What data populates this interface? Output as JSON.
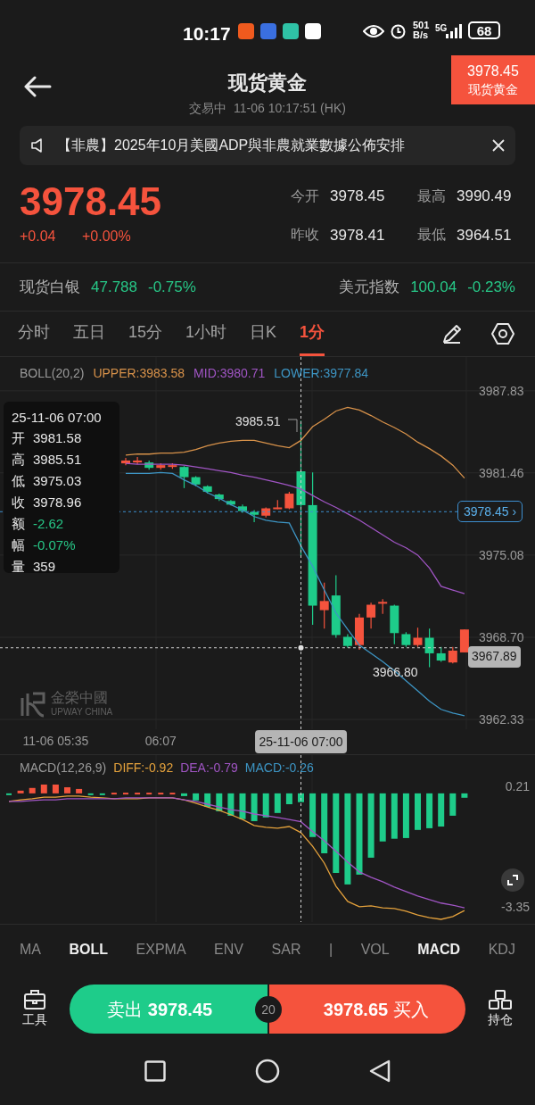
{
  "status_bar": {
    "time": "10:17",
    "speed_value": "501",
    "speed_unit": "B/s",
    "network": "5G",
    "battery": "68"
  },
  "header": {
    "title": "现货黄金",
    "state": "交易中",
    "timestamp": "11-06 10:17:51 (HK)",
    "price_tag": {
      "price": "3978.45",
      "name": "现货黄金"
    }
  },
  "notice": {
    "text": "【非農】2025年10月美國ADP與非農就業數據公佈安排"
  },
  "quote": {
    "price": "3978.45",
    "change": "+0.04",
    "change_pct": "+0.00%",
    "stats": [
      {
        "label": "今开",
        "value": "3978.45"
      },
      {
        "label": "最高",
        "value": "3990.49"
      },
      {
        "label": "昨收",
        "value": "3978.41"
      },
      {
        "label": "最低",
        "value": "3964.51"
      }
    ]
  },
  "related": [
    {
      "name": "现货白银",
      "price": "47.788",
      "change": "-0.75%"
    },
    {
      "name": "美元指数",
      "price": "100.04",
      "change": "-0.23%"
    }
  ],
  "period_tabs": [
    {
      "label": "分时",
      "selected": false
    },
    {
      "label": "五日",
      "selected": false
    },
    {
      "label": "15分",
      "selected": false
    },
    {
      "label": "1小时",
      "selected": false
    },
    {
      "label": "日K",
      "selected": false
    },
    {
      "label": "1分",
      "selected": true
    }
  ],
  "chart": {
    "legend": [
      {
        "text": "BOLL(20,2)",
        "color": "#9a9a9a"
      },
      {
        "text": "UPPER:3983.58",
        "color": "#d8924a"
      },
      {
        "text": "MID:3980.71",
        "color": "#a055c4"
      },
      {
        "text": "LOWER:3977.84",
        "color": "#3d95c4"
      }
    ],
    "current_price_arrow": "›",
    "high_mark": "3985.51",
    "low_mark": "3966.80",
    "watermark": {
      "name": "金榮中國",
      "english": "UPWAY CHINA"
    },
    "tooltip": {
      "title": "25-11-06 07:00",
      "rows": [
        {
          "label": "开",
          "value": "3981.58",
          "color": "#e8e8e8"
        },
        {
          "label": "高",
          "value": "3985.51",
          "color": "#e8e8e8"
        },
        {
          "label": "低",
          "value": "3975.03",
          "color": "#e8e8e8"
        },
        {
          "label": "收",
          "value": "3978.96",
          "color": "#e8e8e8"
        },
        {
          "label": "额",
          "value": "-2.62",
          "color": "#27c787"
        },
        {
          "label": "幅",
          "value": "-0.07%",
          "color": "#27c787"
        },
        {
          "label": "量",
          "value": "359",
          "color": "#e8e8e8"
        }
      ]
    },
    "chart_data": {
      "type": "candlestick",
      "grid": true,
      "ylim": [
        3961.57,
        3990.45
      ],
      "categories": [
        null,
        null,
        null,
        null,
        "11-06 05:35",
        null,
        null,
        null,
        null,
        null,
        null,
        null,
        null,
        "06:07",
        null,
        null,
        null,
        null,
        null,
        null,
        null,
        null,
        null,
        null,
        null,
        "25-11-06 07:00",
        null,
        null,
        null,
        null,
        null,
        null,
        null,
        null,
        null,
        null,
        null,
        null,
        null,
        null
      ],
      "yticks": [
        {
          "value": 3987.83,
          "label": "3987.83"
        },
        {
          "value": 3981.46,
          "label": "3981.46"
        },
        {
          "value": 3975.08,
          "label": "3975.08"
        },
        {
          "value": 3968.7,
          "label": "3968.70"
        },
        {
          "value": 3962.33,
          "label": "3962.33"
        }
      ],
      "ohlc": [
        null,
        null,
        null,
        null,
        null,
        null,
        null,
        null,
        null,
        null,
        [
          3982.2,
          3982.63,
          3982.06,
          3982.42
        ],
        [
          3982.27,
          3982.7,
          3982.13,
          3982.42
        ],
        [
          3982.27,
          3982.42,
          3981.7,
          3981.85
        ],
        [
          3981.85,
          3982.2,
          3981.7,
          3982.06
        ],
        [
          3981.92,
          3982.2,
          3981.78,
          3982.06
        ],
        [
          3981.92,
          3981.99,
          3980.28,
          3981.13
        ],
        [
          3981.13,
          3981.21,
          3980.42,
          3980.56
        ],
        [
          3980.42,
          3980.49,
          3979.85,
          3979.99
        ],
        [
          3979.78,
          3979.85,
          3979.28,
          3979.43
        ],
        [
          3979.28,
          3979.35,
          3978.93,
          3979.0
        ],
        [
          3978.86,
          3979.0,
          3978.36,
          3978.5
        ],
        [
          3978.43,
          3978.57,
          3977.64,
          3978.21
        ],
        [
          3978.14,
          3978.78,
          3978.0,
          3978.71
        ],
        [
          3978.71,
          3979.35,
          3978.64,
          3978.78
        ],
        [
          3978.71,
          3979.99,
          3978.64,
          3979.85
        ],
        [
          3981.58,
          3985.51,
          3975.03,
          3978.96
        ],
        [
          3978.96,
          3981.49,
          3969.67,
          3971.16
        ],
        [
          3970.81,
          3972.94,
          3969.38,
          3971.52
        ],
        [
          3971.95,
          3973.51,
          3968.67,
          3968.88
        ],
        [
          3968.74,
          3968.95,
          3967.89,
          3968.03
        ],
        [
          3968.1,
          3970.52,
          3967.74,
          3970.24
        ],
        [
          3970.24,
          3971.38,
          3969.38,
          3971.23
        ],
        [
          3971.31,
          3971.66,
          3970.52,
          3971.45
        ],
        [
          3971.16,
          3971.23,
          3968.17,
          3969.03
        ],
        [
          3968.95,
          3969.1,
          3967.96,
          3968.1
        ],
        [
          3968.1,
          3969.45,
          3967.96,
          3968.67
        ],
        [
          3968.67,
          3969.38,
          3966.39,
          3967.46
        ],
        [
          3967.46,
          3967.96,
          3966.8,
          3966.9
        ],
        [
          3966.75,
          3967.96,
          3966.68,
          3967.67
        ],
        [
          3967.53,
          3969.31,
          3967.53,
          3969.31
        ]
      ],
      "series": [
        {
          "type": "line",
          "color": "#d8924a",
          "values": [
            null,
            null,
            null,
            null,
            null,
            null,
            null,
            null,
            null,
            null,
            3982.84,
            3982.92,
            3982.92,
            3982.99,
            3982.99,
            3983.06,
            3983.27,
            3983.56,
            3983.77,
            3983.91,
            3983.98,
            3983.98,
            3983.77,
            3983.56,
            3983.41,
            3983.98,
            3985.05,
            3985.62,
            3986.26,
            3986.55,
            3986.33,
            3985.91,
            3985.41,
            3984.98,
            3984.48,
            3983.84,
            3983.34,
            3982.77,
            3982.06,
            3981.06
          ]
        },
        {
          "type": "line",
          "color": "#a055c4",
          "values": [
            null,
            null,
            null,
            null,
            null,
            null,
            null,
            null,
            null,
            null,
            3982.2,
            3982.13,
            3982.13,
            3982.13,
            3982.13,
            3982.06,
            3981.92,
            3981.78,
            3981.63,
            3981.49,
            3981.28,
            3981.13,
            3980.92,
            3980.71,
            3980.49,
            3980.21,
            3979.71,
            3979.21,
            3978.78,
            3978.29,
            3977.79,
            3977.22,
            3976.65,
            3976.08,
            3975.65,
            3975.08,
            3974.08,
            3972.66,
            3972.37,
            3972.09
          ]
        },
        {
          "type": "line",
          "color": "#3d95c4",
          "values": [
            null,
            null,
            null,
            null,
            null,
            null,
            null,
            null,
            null,
            null,
            3981.42,
            3981.42,
            3981.42,
            3981.49,
            3981.42,
            3980.92,
            3980.49,
            3979.92,
            3979.5,
            3979.0,
            3978.57,
            3978.07,
            3977.79,
            3977.64,
            3977.57,
            3975.79,
            3974.22,
            3972.37,
            3970.59,
            3969.31,
            3968.1,
            3967.46,
            3966.82,
            3966.1,
            3965.32,
            3964.54,
            3963.75,
            3963.11,
            3962.83,
            3962.61
          ]
        }
      ],
      "ref_lines": [
        {
          "axis": "y",
          "value": 3978.45,
          "label": "3978.45",
          "color": "#3d8fd0"
        },
        {
          "axis": "y",
          "value": 3967.89,
          "label": "3967.89",
          "color": "#d0d0d0"
        },
        {
          "axis": "x",
          "value": "25-11-06 07:00",
          "color": "#d0d0d0"
        }
      ]
    }
  },
  "macd": {
    "legend": [
      {
        "text": "MACD(12,26,9)",
        "color": "#9a9a9a"
      },
      {
        "text": "DIFF:-0.92",
        "color": "#e5a23c"
      },
      {
        "text": "DEA:-0.79",
        "color": "#a055c4"
      },
      {
        "text": "MACD:-0.26",
        "color": "#3d95c4"
      }
    ],
    "chart_data": {
      "type": "bar",
      "ylim": [
        -3.8,
        1.13
      ],
      "yticks": [
        {
          "value": 0.21,
          "label": "0.21"
        },
        {
          "value": -3.35,
          "label": "-3.35"
        }
      ],
      "series": [
        {
          "color": "#f5533d",
          "values": [
            null,
            0.08,
            0.16,
            0.26,
            0.26,
            0.18,
            0.13,
            null,
            null,
            0.02,
            0.02,
            0.02,
            0.02,
            0.02,
            0.02,
            null,
            null,
            null,
            null,
            null,
            null,
            null,
            null,
            null,
            null,
            null,
            null,
            null,
            null,
            null,
            null,
            null,
            null,
            null,
            null,
            null,
            null,
            null,
            null,
            null
          ]
        },
        {
          "color": "#1ecc8a",
          "values": [
            -0.02,
            null,
            null,
            null,
            null,
            null,
            null,
            -0.02,
            -0.02,
            null,
            null,
            null,
            null,
            null,
            null,
            -0.08,
            -0.21,
            -0.4,
            -0.53,
            -0.66,
            -0.76,
            -0.82,
            -0.71,
            -0.58,
            -0.32,
            -0.26,
            -1.29,
            -1.77,
            -2.35,
            -2.69,
            -2.4,
            -1.9,
            -1.42,
            -1.34,
            -1.32,
            -1.08,
            -1.03,
            -0.98,
            -0.66,
            -0.13
          ]
        },
        {
          "type": "line",
          "color": "#e5a23c",
          "values": [
            -0.24,
            -0.19,
            -0.16,
            -0.11,
            -0.11,
            -0.08,
            -0.08,
            -0.11,
            -0.13,
            -0.16,
            -0.16,
            -0.16,
            -0.13,
            -0.13,
            -0.13,
            -0.19,
            -0.29,
            -0.4,
            -0.5,
            -0.63,
            -0.77,
            -0.95,
            -1.0,
            -1.03,
            -0.98,
            -1.16,
            -1.56,
            -2.06,
            -2.74,
            -3.19,
            -3.35,
            -3.32,
            -3.38,
            -3.4,
            -3.48,
            -3.59,
            -3.67,
            -3.72,
            -3.64,
            -3.46
          ]
        },
        {
          "type": "line",
          "color": "#a055c4",
          "values": [
            -0.24,
            -0.24,
            -0.21,
            -0.19,
            -0.19,
            -0.16,
            -0.16,
            -0.16,
            -0.16,
            -0.16,
            -0.13,
            -0.13,
            -0.13,
            -0.13,
            -0.13,
            -0.19,
            -0.24,
            -0.32,
            -0.4,
            -0.48,
            -0.53,
            -0.61,
            -0.66,
            -0.71,
            -0.77,
            -0.84,
            -1.13,
            -1.4,
            -1.71,
            -2.03,
            -2.32,
            -2.48,
            -2.61,
            -2.77,
            -2.9,
            -3.03,
            -3.14,
            -3.24,
            -3.3,
            -3.38
          ]
        }
      ]
    }
  },
  "indicator_tabs": [
    {
      "kind": "tab",
      "label": "MA",
      "selected": false
    },
    {
      "kind": "tab",
      "label": "BOLL",
      "selected": true
    },
    {
      "kind": "tab",
      "label": "EXPMA",
      "selected": false
    },
    {
      "kind": "tab",
      "label": "ENV",
      "selected": false
    },
    {
      "kind": "tab",
      "label": "SAR",
      "selected": false
    },
    {
      "kind": "separator",
      "label": "|"
    },
    {
      "kind": "tab",
      "label": "VOL",
      "selected": false
    },
    {
      "kind": "tab",
      "label": "MACD",
      "selected": true
    },
    {
      "kind": "tab",
      "label": "KDJ",
      "selected": false
    }
  ],
  "trade": {
    "tools": "工具",
    "sell_label": "卖出",
    "sell_price": "3978.45",
    "spread": "20",
    "buy_price": "3978.65",
    "buy_label": "买入",
    "positions": "持仓"
  }
}
